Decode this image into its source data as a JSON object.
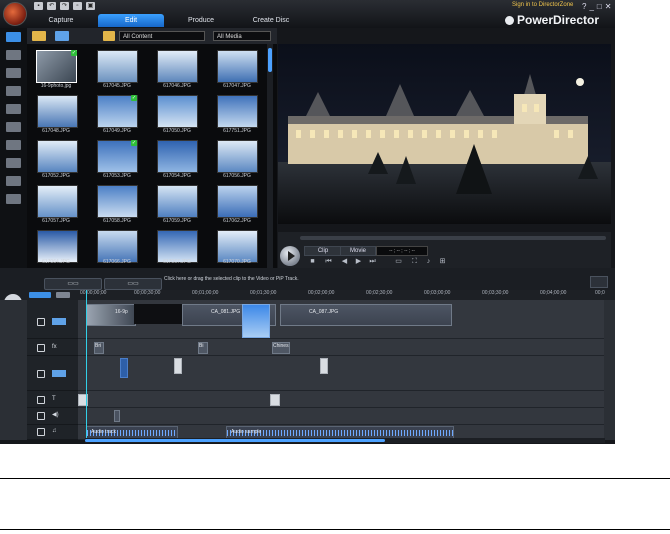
{
  "window": {
    "brand": "PowerDirector",
    "sign_in": "Sign in to DirectorZone",
    "tabs": [
      "Capture",
      "Edit",
      "Produce",
      "Create Disc"
    ],
    "active_tab": "Edit"
  },
  "library": {
    "filter_content": "All Content",
    "filter_media": "All Media",
    "items": [
      {
        "label": "16-9photo.jpg",
        "checked": true
      },
      {
        "label": "617045.JPG",
        "checked": false
      },
      {
        "label": "617046.JPG",
        "checked": false
      },
      {
        "label": "617047.JPG",
        "checked": false
      },
      {
        "label": "617048.JPG",
        "checked": false
      },
      {
        "label": "617049.JPG",
        "checked": true
      },
      {
        "label": "617050.JPG",
        "checked": false
      },
      {
        "label": "617751.JPG",
        "checked": false
      },
      {
        "label": "617052.JPG",
        "checked": false
      },
      {
        "label": "617053.JPG",
        "checked": true
      },
      {
        "label": "617054.JPG",
        "checked": false
      },
      {
        "label": "617056.JPG",
        "checked": false
      },
      {
        "label": "617057.JPG",
        "checked": false
      },
      {
        "label": "617058.JPG",
        "checked": false
      },
      {
        "label": "617059.JPG",
        "checked": false
      },
      {
        "label": "617062.JPG",
        "checked": false
      },
      {
        "label": "617064.JPG",
        "checked": false
      },
      {
        "label": "617066.JPG",
        "checked": false
      },
      {
        "label": "617067.JPG",
        "checked": false
      },
      {
        "label": "617070.JPG",
        "checked": false
      }
    ]
  },
  "player": {
    "clip_label": "Clip",
    "movie_label": "Movie",
    "timecode": "-- ; -- ; -- ; --"
  },
  "timeline": {
    "hint": "Click here or drag the selected clip to the Video or PiP Track.",
    "ruler": [
      "00;00;00;00",
      "00;00;30;00",
      "00;01;00;00",
      "00;01;30;00",
      "00;02;00;00",
      "00;02;30;00",
      "00;03;00;00",
      "00;03;30;00",
      "00;04;00;00",
      "00;0"
    ],
    "video_clips": [
      {
        "name": "16-9p"
      },
      {
        "name": "CA_081.JPG"
      },
      {
        "name": "CA_087.JPG"
      }
    ],
    "text_clips": [
      "Bri",
      "Bi",
      "Chines"
    ],
    "audio_clips": [
      "Audio track",
      "Audio sample"
    ]
  },
  "colors": {
    "accent": "#3aa0ff",
    "playhead": "#32d0e8",
    "background": "#15171b"
  }
}
